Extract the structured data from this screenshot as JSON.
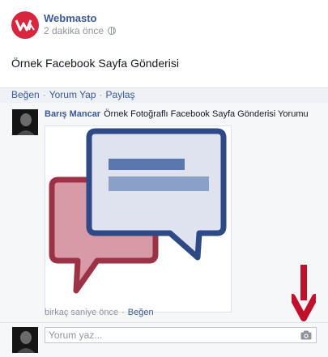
{
  "post": {
    "page_name": "Webmasto",
    "timestamp": "2 dakika önce",
    "text": "Örnek Facebook Sayfa Gönderisi",
    "actions": {
      "like": "Beğen",
      "comment": "Yorum Yap",
      "share": "Paylaş",
      "sep": "·"
    }
  },
  "comment": {
    "author": "Barış Mancar",
    "text": "Örnek Fotoğraflı Facebook Sayfa Gönderisi Yorumu",
    "time": "birkaç saniye önce",
    "like": "Beğen",
    "sep": "·"
  },
  "reply": {
    "placeholder": "Yorum yaz..."
  },
  "colors": {
    "brand": "#3b5998",
    "logo_red": "#d7263d",
    "arrow_red": "#c0102a"
  },
  "icons": {
    "privacy": "globe-icon",
    "camera": "camera-icon"
  }
}
